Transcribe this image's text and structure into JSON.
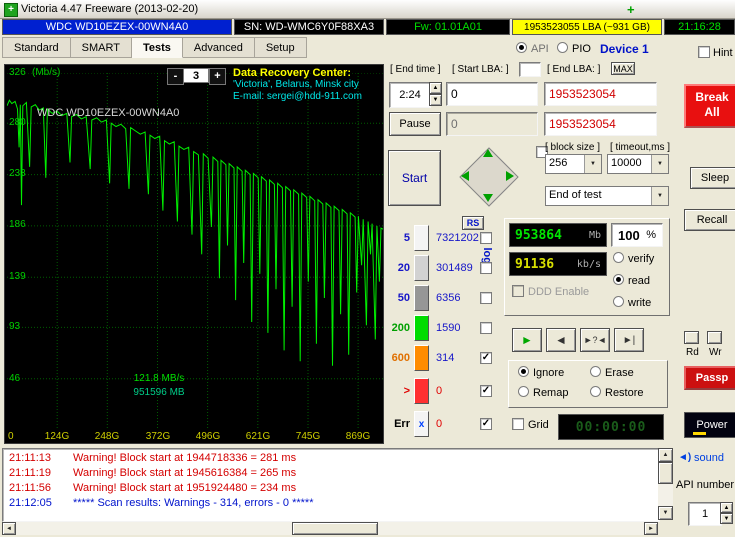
{
  "window": {
    "title": "Victoria 4.47 Freeware (2013-02-20)"
  },
  "icons": {
    "app_glyph": "+",
    "tray_plus": "+",
    "dropdown": "▼",
    "up": "▲",
    "down": "▼",
    "left": "◄",
    "right": "►",
    "check": "✓",
    "play": "►",
    "step_back": "◄",
    "seek_mid": "►?◄",
    "step_end": "►|",
    "sound": "◄)",
    "err_cross": "x"
  },
  "header": {
    "model": "WDC WD10EZEX-00WN4A0",
    "serial": "SN: WD-WMC6Y0F88XA3",
    "firmware": "Fw: 01.01A01",
    "capacity": "1953523055 LBA (~931 GB)",
    "clock": "21:16:28"
  },
  "tabs": {
    "items": [
      "Standard",
      "SMART",
      "Tests",
      "Advanced",
      "Setup"
    ],
    "active_index": 2,
    "api_label": "API",
    "api_selected": true,
    "pio_label": "PIO",
    "pio_selected": false,
    "device_label": "Device 1",
    "hint_label": "Hint",
    "hint_checked": false
  },
  "graph": {
    "y_unit": "(Mb/s)",
    "y_ticks": [
      "326",
      "280",
      "233",
      "186",
      "139",
      "93",
      "46"
    ],
    "x_ticks": [
      "0",
      "124G",
      "248G",
      "372G",
      "496G",
      "621G",
      "745G",
      "869G"
    ],
    "scale_minus": "-",
    "scale_value": "3",
    "scale_plus": "+",
    "drc_title": "Data Recovery Center:",
    "drc_line2": "'Victoria', Belarus, Minsk city",
    "drc_line3": "E-mail: sergei@hdd-911.com",
    "drive_label": "WDC WD10EZEX-00WN4A0",
    "speed_label": "121.8 MB/s",
    "position_label": "951596 MB"
  },
  "chart_data": {
    "type": "line",
    "x_unit": "GB",
    "y_unit": "MB/s",
    "xlim": [
      0,
      931
    ],
    "ylim": [
      0,
      326
    ],
    "x_tick_step_gb": 124.2,
    "points": [
      [
        0,
        296
      ],
      [
        6,
        301
      ],
      [
        12,
        298
      ],
      [
        20,
        300
      ],
      [
        26,
        293
      ],
      [
        30,
        258
      ],
      [
        33,
        297
      ],
      [
        36,
        205
      ],
      [
        39,
        296
      ],
      [
        48,
        299
      ],
      [
        56,
        240
      ],
      [
        60,
        295
      ],
      [
        70,
        297
      ],
      [
        80,
        292
      ],
      [
        90,
        294
      ],
      [
        96,
        230
      ],
      [
        100,
        293
      ],
      [
        112,
        289
      ],
      [
        124,
        291
      ],
      [
        136,
        287
      ],
      [
        148,
        289
      ],
      [
        156,
        244
      ],
      [
        160,
        286
      ],
      [
        172,
        288
      ],
      [
        184,
        284
      ],
      [
        196,
        286
      ],
      [
        206,
        238
      ],
      [
        210,
        283
      ],
      [
        222,
        285
      ],
      [
        234,
        281
      ],
      [
        246,
        283
      ],
      [
        254,
        225
      ],
      [
        258,
        280
      ],
      [
        270,
        277
      ],
      [
        282,
        279
      ],
      [
        294,
        275
      ],
      [
        302,
        220
      ],
      [
        306,
        276
      ],
      [
        318,
        273
      ],
      [
        330,
        270
      ],
      [
        342,
        272
      ],
      [
        350,
        215
      ],
      [
        354,
        269
      ],
      [
        366,
        266
      ],
      [
        378,
        268
      ],
      [
        386,
        200
      ],
      [
        390,
        264
      ],
      [
        402,
        261
      ],
      [
        414,
        263
      ],
      [
        422,
        190
      ],
      [
        426,
        259
      ],
      [
        438,
        256
      ],
      [
        450,
        258
      ],
      [
        458,
        178
      ],
      [
        462,
        254
      ],
      [
        474,
        251
      ],
      [
        482,
        160
      ],
      [
        486,
        252
      ],
      [
        498,
        248
      ],
      [
        506,
        185
      ],
      [
        510,
        249
      ],
      [
        522,
        245
      ],
      [
        526,
        138
      ],
      [
        530,
        246
      ],
      [
        542,
        242
      ],
      [
        546,
        168
      ],
      [
        550,
        243
      ],
      [
        562,
        239
      ],
      [
        566,
        118
      ],
      [
        570,
        240
      ],
      [
        582,
        236
      ],
      [
        586,
        152
      ],
      [
        590,
        237
      ],
      [
        602,
        233
      ],
      [
        606,
        98
      ],
      [
        610,
        234
      ],
      [
        622,
        230
      ],
      [
        626,
        142
      ],
      [
        630,
        231
      ],
      [
        642,
        227
      ],
      [
        646,
        88
      ],
      [
        650,
        228
      ],
      [
        662,
        224
      ],
      [
        666,
        128
      ],
      [
        670,
        225
      ],
      [
        682,
        221
      ],
      [
        686,
        72
      ],
      [
        690,
        222
      ],
      [
        702,
        218
      ],
      [
        706,
        112
      ],
      [
        710,
        219
      ],
      [
        722,
        215
      ],
      [
        726,
        62
      ],
      [
        730,
        216
      ],
      [
        742,
        212
      ],
      [
        746,
        135
      ],
      [
        750,
        213
      ],
      [
        762,
        209
      ],
      [
        766,
        78
      ],
      [
        770,
        210
      ],
      [
        782,
        206
      ],
      [
        786,
        120
      ],
      [
        790,
        207
      ],
      [
        802,
        203
      ],
      [
        806,
        58
      ],
      [
        810,
        204
      ],
      [
        822,
        200
      ],
      [
        826,
        105
      ],
      [
        830,
        201
      ],
      [
        842,
        197
      ],
      [
        846,
        68
      ],
      [
        850,
        198
      ],
      [
        862,
        194
      ],
      [
        866,
        125
      ],
      [
        870,
        195
      ],
      [
        878,
        150
      ],
      [
        882,
        192
      ],
      [
        890,
        95
      ],
      [
        894,
        190
      ],
      [
        900,
        160
      ],
      [
        904,
        188
      ],
      [
        912,
        82
      ],
      [
        916,
        186
      ],
      [
        922,
        135
      ],
      [
        926,
        184
      ],
      [
        931,
        183
      ]
    ]
  },
  "test_controls": {
    "end_time_label": "[ End time ]",
    "end_time_value": "2:24",
    "start_lba_label": "[ Start LBA: ]",
    "start_lba_mini": "",
    "start_lba_value": "0",
    "end_lba_label": "[ End LBA: ]",
    "max_button": "MAX",
    "end_lba_value": "1953523054",
    "pause_button": "Pause",
    "remaining_value": "0",
    "end_lba_value2": "1953523054",
    "start_button": "Start",
    "block_size_label": "[ block size ]",
    "block_size_value": "256",
    "timeout_label": "[ timeout,ms ]",
    "timeout_value": "10000",
    "end_action_value": "End of test"
  },
  "legend": {
    "rs_button": "RS",
    "to_log_label": "to log:",
    "rows": [
      {
        "label": "5",
        "count": "7321202",
        "color": "#f4f4f4",
        "label_color": "#1616c8",
        "count_color": "#1616c8",
        "checked": false
      },
      {
        "label": "20",
        "count": "301489",
        "color": "#d2d2d2",
        "label_color": "#1616c8",
        "count_color": "#1616c8",
        "checked": false
      },
      {
        "label": "50",
        "count": "6356",
        "color": "#969696",
        "label_color": "#1616c8",
        "count_color": "#1616c8",
        "checked": false
      },
      {
        "label": "200",
        "count": "1590",
        "color": "#00dc00",
        "label_color": "#00a000",
        "count_color": "#1616c8",
        "checked": false
      },
      {
        "label": "600",
        "count": "314",
        "color": "#ff8c00",
        "label_color": "#e07000",
        "count_color": "#1616c8",
        "checked": true
      },
      {
        "label": ">",
        "count": "0",
        "color": "#ff3030",
        "label_color": "#e00000",
        "count_color": "#e00000",
        "checked": true
      },
      {
        "label": "Err",
        "count": "0",
        "color": "err",
        "label_color": "#000000",
        "count_color": "#e00000",
        "checked": true
      }
    ]
  },
  "readout": {
    "mb_value": "953864",
    "mb_unit": "Mb",
    "percent_value": "100",
    "percent_sign": "%",
    "speed_value": "91136",
    "speed_unit": "kb/s",
    "ddd_label": "DDD Enable",
    "ddd_checked": false,
    "mode_options": [
      {
        "label": "verify",
        "selected": false
      },
      {
        "label": "read",
        "selected": true
      },
      {
        "label": "write",
        "selected": false
      }
    ],
    "action_options": [
      {
        "label": "Ignore",
        "selected": true
      },
      {
        "label": "Erase",
        "selected": false
      },
      {
        "label": "Remap",
        "selected": false
      },
      {
        "label": "Restore",
        "selected": false
      }
    ],
    "grid_label": "Grid",
    "grid_checked": false,
    "timer_value": "00:00:00"
  },
  "right_panel": {
    "break_line1": "Break",
    "break_line2": "All",
    "sleep_button": "Sleep",
    "recall_button": "Recall",
    "rd_label": "Rd",
    "wr_label": "Wr",
    "passp_button": "Passp",
    "power_button": "Power",
    "sound_label": "sound",
    "api_number_label": "API number",
    "api_number_value": "1"
  },
  "log": {
    "entries": [
      {
        "time": "21:11:13",
        "message": "Warning! Block start at 1944718336 = 281 ms",
        "color": "#d40000"
      },
      {
        "time": "21:11:19",
        "message": "Warning! Block start at 1945616384 = 265 ms",
        "color": "#d40000"
      },
      {
        "time": "21:11:56",
        "message": "Warning! Block start at 1951924480 = 234 ms",
        "color": "#d40000"
      },
      {
        "time": "21:12:05",
        "message": "***** Scan results: Warnings - 314, errors - 0 *****",
        "color": "#0013cc"
      }
    ]
  }
}
